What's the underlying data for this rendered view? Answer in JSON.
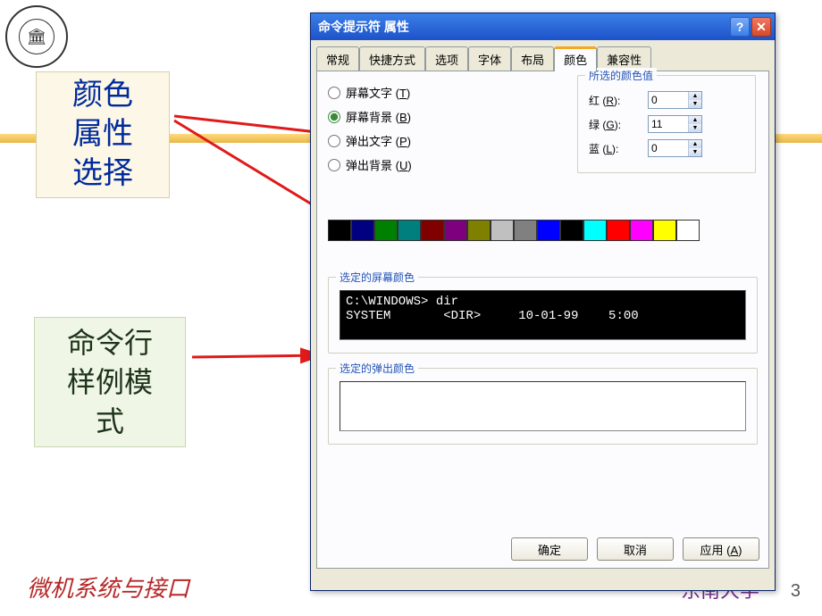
{
  "slide": {
    "callout1_line1": "颜色",
    "callout1_line2": "属性",
    "callout1_line3": "选择",
    "callout2_line1": "命令行",
    "callout2_line2": "样例模",
    "callout2_line3": "式",
    "footer_left": "微机系统与接口",
    "footer_right_deco": "东南大学",
    "page_number": "3"
  },
  "dialog": {
    "title": "命令提示符 属性",
    "tabs": [
      "常规",
      "快捷方式",
      "选项",
      "字体",
      "布局",
      "颜色",
      "兼容性"
    ],
    "active_tab": "颜色",
    "radios": {
      "screen_text": {
        "label": "屏幕文字",
        "key": "T"
      },
      "screen_bg": {
        "label": "屏幕背景",
        "key": "B"
      },
      "popup_text": {
        "label": "弹出文字",
        "key": "P"
      },
      "popup_bg": {
        "label": "弹出背景",
        "key": "U"
      },
      "selected": "screen_bg"
    },
    "color_values": {
      "legend": "所选的颜色值",
      "red": {
        "label": "红",
        "key": "R",
        "value": "0"
      },
      "green": {
        "label": "绿",
        "key": "G",
        "value": "11"
      },
      "blue": {
        "label": "蓝",
        "key": "L",
        "value": "0"
      }
    },
    "swatches": [
      "#000000",
      "#000080",
      "#008000",
      "#007f7f",
      "#800000",
      "#7f007f",
      "#7f7f00",
      "#c0c0c0",
      "#808080",
      "#0000ff",
      "#000000",
      "#00ffff",
      "#ff0000",
      "#ff00ff",
      "#ffff00",
      "#ffffff"
    ],
    "group_screen": {
      "legend": "选定的屏幕颜色",
      "line1": "C:\\WINDOWS> dir",
      "line2": "SYSTEM       <DIR>     10-01-99    5:00"
    },
    "group_popup": {
      "legend": "选定的弹出颜色"
    },
    "buttons": {
      "ok": "确定",
      "cancel": "取消",
      "apply": "应用",
      "apply_key": "A"
    }
  }
}
